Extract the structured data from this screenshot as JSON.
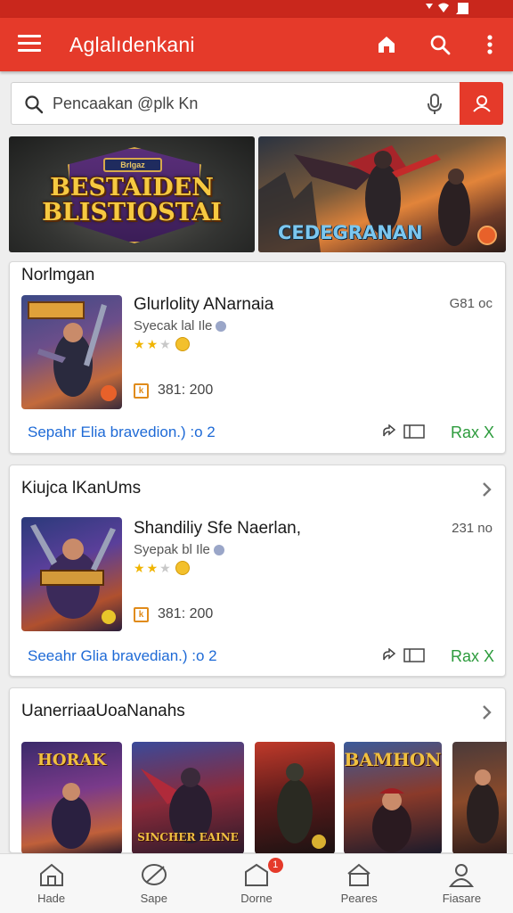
{
  "colors": {
    "brand": "#e53a2a",
    "statusbar": "#c9271c",
    "link": "#1e6ad6",
    "install": "#2c9b3c",
    "star": "#f0b400"
  },
  "appbar": {
    "title": "Aglalıdenkani",
    "icons": [
      "menu-icon",
      "home-icon",
      "search-icon",
      "more-vert-icon"
    ]
  },
  "search": {
    "placeholder": "Pencaakan @plk Kn",
    "icons": [
      "search-icon",
      "mic-icon",
      "account-icon"
    ]
  },
  "banners": [
    {
      "line1": "BESTAIDEN",
      "line2": "BLISTIOSTAI",
      "crest": "Brlgaz"
    },
    {
      "title": "CEDEGRANAN"
    }
  ],
  "section1": {
    "title": "Norlmgan",
    "app": {
      "name": "Glurlolity ANarnaia",
      "developer": "Syecak lal Ile",
      "rating": 2.5,
      "size": "G81 oc",
      "stat": "381:  200",
      "link": "Sepahr Elia bravedion.) :o 2",
      "install": "Rax X"
    }
  },
  "section2": {
    "title": "Kiujca lKanUms",
    "app": {
      "name": "Shandiliy Sfe Naerlan,",
      "developer": "Syepak bl Ile",
      "rating": 2.5,
      "size": "231 no",
      "stat": "381:  200",
      "link": "Seeahr Glia bravedian.) :o 2",
      "install": "Rax X"
    }
  },
  "section3": {
    "title": "UanerriaaUoaNanahs",
    "thumbs": [
      {
        "caption": "HORAK"
      },
      {
        "caption": "SINCHER EAINE"
      },
      {
        "caption": ""
      },
      {
        "caption": "BAMHON"
      },
      {
        "caption": ""
      }
    ]
  },
  "bottom_nav": [
    {
      "label": "Hade",
      "icon": "home-icon"
    },
    {
      "label": "Sape",
      "icon": "leaf-icon"
    },
    {
      "label": "Dorne",
      "icon": "download-icon",
      "badge": "1"
    },
    {
      "label": "Peares",
      "icon": "house-icon"
    },
    {
      "label": "Fiasare",
      "icon": "profile-icon"
    }
  ]
}
